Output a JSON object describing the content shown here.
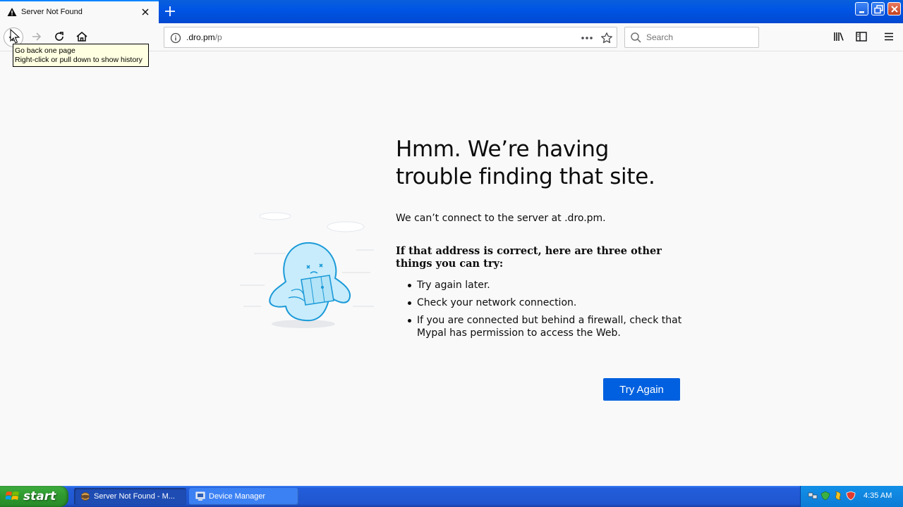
{
  "tab": {
    "title": "Server Not Found"
  },
  "navbar": {
    "url_host": ".dro.pm",
    "url_path": "/p",
    "search_placeholder": "Search"
  },
  "tooltip": {
    "line1": "Go back one page",
    "line2": "Right-click or pull down to show history"
  },
  "error": {
    "title": "Hmm. We’re having trouble finding that site.",
    "description": "We can’t connect to the server at .dro.pm.",
    "suggestions_heading": "If that address is correct, here are three other things you can try:",
    "suggestions": [
      "Try again later.",
      "Check your network connection.",
      "If you are connected but behind a firewall, check that Mypal has permission to access the Web."
    ],
    "try_again_label": "Try Again"
  },
  "taskbar": {
    "start_label": "start",
    "tasks": [
      {
        "label": "Server Not Found - M...",
        "icon": "mypal-icon"
      },
      {
        "label": "Device Manager",
        "icon": "device-manager-icon"
      }
    ],
    "clock": "4:35 AM"
  },
  "colors": {
    "accent": "#0060df",
    "xp_blue": "#245edb",
    "page_bg": "#f9f9fa"
  }
}
